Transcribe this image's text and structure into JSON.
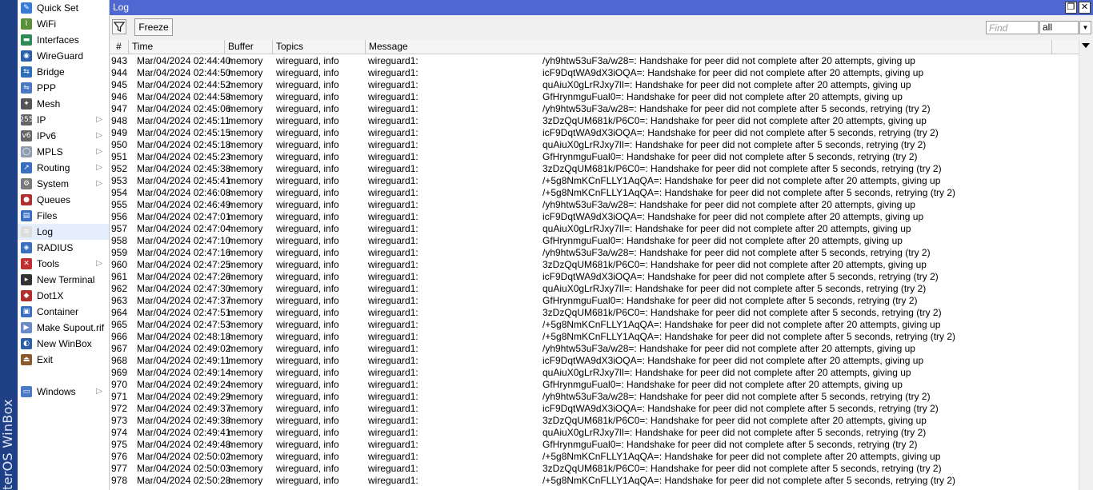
{
  "brand": "terOS WinBox",
  "sidebar": {
    "items": [
      {
        "label": "Quick Set",
        "icon": "quick-set-icon",
        "color": "#3a7bd5",
        "glyph": "✎",
        "submenu": false
      },
      {
        "label": "WiFi",
        "icon": "wifi-icon",
        "color": "#5a8f3c",
        "glyph": "⌇",
        "submenu": false
      },
      {
        "label": "Interfaces",
        "icon": "interfaces-icon",
        "color": "#2e8b57",
        "glyph": "▬",
        "submenu": false
      },
      {
        "label": "WireGuard",
        "icon": "wireguard-icon",
        "color": "#2b5fa8",
        "glyph": "◉",
        "submenu": false
      },
      {
        "label": "Bridge",
        "icon": "bridge-icon",
        "color": "#2f6fb8",
        "glyph": "⇆",
        "submenu": false
      },
      {
        "label": "PPP",
        "icon": "ppp-icon",
        "color": "#4a78c2",
        "glyph": "⇋",
        "submenu": false
      },
      {
        "label": "Mesh",
        "icon": "mesh-icon",
        "color": "#555555",
        "glyph": "✦",
        "submenu": false
      },
      {
        "label": "IP",
        "icon": "ip-icon",
        "color": "#666666",
        "glyph": "255",
        "submenu": true
      },
      {
        "label": "IPv6",
        "icon": "ipv6-icon",
        "color": "#666666",
        "glyph": "v6",
        "submenu": true
      },
      {
        "label": "MPLS",
        "icon": "mpls-icon",
        "color": "#8f9db0",
        "glyph": "◯",
        "submenu": true
      },
      {
        "label": "Routing",
        "icon": "routing-icon",
        "color": "#3a6fc0",
        "glyph": "↗",
        "submenu": true
      },
      {
        "label": "System",
        "icon": "system-icon",
        "color": "#7a7a7a",
        "glyph": "⚙",
        "submenu": true
      },
      {
        "label": "Queues",
        "icon": "queues-icon",
        "color": "#b03030",
        "glyph": "●",
        "submenu": false
      },
      {
        "label": "Files",
        "icon": "files-icon",
        "color": "#3a6fc0",
        "glyph": "▤",
        "submenu": false
      },
      {
        "label": "Log",
        "icon": "log-icon",
        "color": "#dcdcdc",
        "glyph": "≡",
        "submenu": false
      },
      {
        "label": "RADIUS",
        "icon": "radius-icon",
        "color": "#3a6fc0",
        "glyph": "◈",
        "submenu": false
      },
      {
        "label": "Tools",
        "icon": "tools-icon",
        "color": "#c03030",
        "glyph": "✕",
        "submenu": true
      },
      {
        "label": "New Terminal",
        "icon": "terminal-icon",
        "color": "#333333",
        "glyph": "▸",
        "submenu": false
      },
      {
        "label": "Dot1X",
        "icon": "dot1x-icon",
        "color": "#b03030",
        "glyph": "◆",
        "submenu": false
      },
      {
        "label": "Container",
        "icon": "container-icon",
        "color": "#3a6fc0",
        "glyph": "▣",
        "submenu": false
      },
      {
        "label": "Make Supout.rif",
        "icon": "supout-icon",
        "color": "#6a8ac8",
        "glyph": "▶",
        "submenu": false
      },
      {
        "label": "New WinBox",
        "icon": "winbox-icon",
        "color": "#2b5fa8",
        "glyph": "◐",
        "submenu": false
      },
      {
        "label": "Exit",
        "icon": "exit-icon",
        "color": "#8a5a2a",
        "glyph": "⏏",
        "submenu": false
      }
    ],
    "windows": {
      "label": "Windows",
      "icon": "windows-icon",
      "color": "#4a7ac8",
      "glyph": "▭",
      "submenu": true
    }
  },
  "window": {
    "title": "Log",
    "restore_glyph": "❐",
    "close_glyph": "✕"
  },
  "toolbar": {
    "freeze_label": "Freeze",
    "find_placeholder": "Find",
    "topic_value": "all",
    "topic_drop_glyph": "▼"
  },
  "table": {
    "columns": [
      "#",
      "Time",
      "Buffer",
      "Topics",
      "Message"
    ],
    "rows": [
      {
        "num": "943",
        "time": "Mar/04/2024 02:44:40",
        "buffer": "memory",
        "topics": "wireguard, info",
        "msg": "wireguard1:",
        "tail": "/yh9htw53uF3a/w28=: Handshake for peer did not complete after 20 attempts, giving up"
      },
      {
        "num": "944",
        "time": "Mar/04/2024 02:44:50",
        "buffer": "memory",
        "topics": "wireguard, info",
        "msg": "wireguard1:",
        "tail": "icF9DqtWA9dX3iOQA=: Handshake for peer did not complete after 20 attempts, giving up"
      },
      {
        "num": "945",
        "time": "Mar/04/2024 02:44:52",
        "buffer": "memory",
        "topics": "wireguard, info",
        "msg": "wireguard1:",
        "tail": "quAiuX0gLrRJxy7lI=: Handshake for peer did not complete after 20 attempts, giving up"
      },
      {
        "num": "946",
        "time": "Mar/04/2024 02:44:58",
        "buffer": "memory",
        "topics": "wireguard, info",
        "msg": "wireguard1:",
        "tail": "GfHrynmguFual0=: Handshake for peer did not complete after 20 attempts, giving up"
      },
      {
        "num": "947",
        "time": "Mar/04/2024 02:45:06",
        "buffer": "memory",
        "topics": "wireguard, info",
        "msg": "wireguard1:",
        "tail": "/yh9htw53uF3a/w28=: Handshake for peer did not complete after 5 seconds, retrying (try 2)"
      },
      {
        "num": "948",
        "time": "Mar/04/2024 02:45:11",
        "buffer": "memory",
        "topics": "wireguard, info",
        "msg": "wireguard1:",
        "tail": "3zDzQqUM681k/P6C0=: Handshake for peer did not complete after 20 attempts, giving up"
      },
      {
        "num": "949",
        "time": "Mar/04/2024 02:45:15",
        "buffer": "memory",
        "topics": "wireguard, info",
        "msg": "wireguard1:",
        "tail": "icF9DqtWA9dX3iOQA=: Handshake for peer did not complete after 5 seconds, retrying (try 2)"
      },
      {
        "num": "950",
        "time": "Mar/04/2024 02:45:18",
        "buffer": "memory",
        "topics": "wireguard, info",
        "msg": "wireguard1:",
        "tail": "quAiuX0gLrRJxy7lI=: Handshake for peer did not complete after 5 seconds, retrying (try 2)"
      },
      {
        "num": "951",
        "time": "Mar/04/2024 02:45:23",
        "buffer": "memory",
        "topics": "wireguard, info",
        "msg": "wireguard1:",
        "tail": "GfHrynmguFual0=: Handshake for peer did not complete after 5 seconds, retrying (try 2)"
      },
      {
        "num": "952",
        "time": "Mar/04/2024 02:45:38",
        "buffer": "memory",
        "topics": "wireguard, info",
        "msg": "wireguard1:",
        "tail": "3zDzQqUM681k/P6C0=: Handshake for peer did not complete after 5 seconds, retrying (try 2)"
      },
      {
        "num": "953",
        "time": "Mar/04/2024 02:45:41",
        "buffer": "memory",
        "topics": "wireguard, info",
        "msg": "wireguard1:",
        "tail": "/+5g8NmKCnFLLY1AqQA=: Handshake for peer did not complete after 20 attempts, giving up"
      },
      {
        "num": "954",
        "time": "Mar/04/2024 02:46:08",
        "buffer": "memory",
        "topics": "wireguard, info",
        "msg": "wireguard1:",
        "tail": "/+5g8NmKCnFLLY1AqQA=: Handshake for peer did not complete after 5 seconds, retrying (try 2)"
      },
      {
        "num": "955",
        "time": "Mar/04/2024 02:46:49",
        "buffer": "memory",
        "topics": "wireguard, info",
        "msg": "wireguard1:",
        "tail": "/yh9htw53uF3a/w28=: Handshake for peer did not complete after 20 attempts, giving up"
      },
      {
        "num": "956",
        "time": "Mar/04/2024 02:47:01",
        "buffer": "memory",
        "topics": "wireguard, info",
        "msg": "wireguard1:",
        "tail": "icF9DqtWA9dX3iOQA=: Handshake for peer did not complete after 20 attempts, giving up"
      },
      {
        "num": "957",
        "time": "Mar/04/2024 02:47:04",
        "buffer": "memory",
        "topics": "wireguard, info",
        "msg": "wireguard1:",
        "tail": "quAiuX0gLrRJxy7lI=: Handshake for peer did not complete after 20 attempts, giving up"
      },
      {
        "num": "958",
        "time": "Mar/04/2024 02:47:10",
        "buffer": "memory",
        "topics": "wireguard, info",
        "msg": "wireguard1:",
        "tail": "GfHrynmguFual0=: Handshake for peer did not complete after 20 attempts, giving up"
      },
      {
        "num": "959",
        "time": "Mar/04/2024 02:47:16",
        "buffer": "memory",
        "topics": "wireguard, info",
        "msg": "wireguard1:",
        "tail": "/yh9htw53uF3a/w28=: Handshake for peer did not complete after 5 seconds, retrying (try 2)"
      },
      {
        "num": "960",
        "time": "Mar/04/2024 02:47:25",
        "buffer": "memory",
        "topics": "wireguard, info",
        "msg": "wireguard1:",
        "tail": "3zDzQqUM681k/P6C0=: Handshake for peer did not complete after 20 attempts, giving up"
      },
      {
        "num": "961",
        "time": "Mar/04/2024 02:47:26",
        "buffer": "memory",
        "topics": "wireguard, info",
        "msg": "wireguard1:",
        "tail": "icF9DqtWA9dX3iOQA=: Handshake for peer did not complete after 5 seconds, retrying (try 2)"
      },
      {
        "num": "962",
        "time": "Mar/04/2024 02:47:30",
        "buffer": "memory",
        "topics": "wireguard, info",
        "msg": "wireguard1:",
        "tail": "quAiuX0gLrRJxy7lI=: Handshake for peer did not complete after 5 seconds, retrying (try 2)"
      },
      {
        "num": "963",
        "time": "Mar/04/2024 02:47:37",
        "buffer": "memory",
        "topics": "wireguard, info",
        "msg": "wireguard1:",
        "tail": "GfHrynmguFual0=: Handshake for peer did not complete after 5 seconds, retrying (try 2)"
      },
      {
        "num": "964",
        "time": "Mar/04/2024 02:47:51",
        "buffer": "memory",
        "topics": "wireguard, info",
        "msg": "wireguard1:",
        "tail": "3zDzQqUM681k/P6C0=: Handshake for peer did not complete after 5 seconds, retrying (try 2)"
      },
      {
        "num": "965",
        "time": "Mar/04/2024 02:47:53",
        "buffer": "memory",
        "topics": "wireguard, info",
        "msg": "wireguard1:",
        "tail": "/+5g8NmKCnFLLY1AqQA=: Handshake for peer did not complete after 20 attempts, giving up"
      },
      {
        "num": "966",
        "time": "Mar/04/2024 02:48:18",
        "buffer": "memory",
        "topics": "wireguard, info",
        "msg": "wireguard1:",
        "tail": "/+5g8NmKCnFLLY1AqQA=: Handshake for peer did not complete after 5 seconds, retrying (try 2)"
      },
      {
        "num": "967",
        "time": "Mar/04/2024 02:49:02",
        "buffer": "memory",
        "topics": "wireguard, info",
        "msg": "wireguard1:",
        "tail": "/yh9htw53uF3a/w28=: Handshake for peer did not complete after 20 attempts, giving up"
      },
      {
        "num": "968",
        "time": "Mar/04/2024 02:49:11",
        "buffer": "memory",
        "topics": "wireguard, info",
        "msg": "wireguard1:",
        "tail": "icF9DqtWA9dX3iOQA=: Handshake for peer did not complete after 20 attempts, giving up"
      },
      {
        "num": "969",
        "time": "Mar/04/2024 02:49:14",
        "buffer": "memory",
        "topics": "wireguard, info",
        "msg": "wireguard1:",
        "tail": "quAiuX0gLrRJxy7lI=: Handshake for peer did not complete after 20 attempts, giving up"
      },
      {
        "num": "970",
        "time": "Mar/04/2024 02:49:24",
        "buffer": "memory",
        "topics": "wireguard, info",
        "msg": "wireguard1:",
        "tail": "GfHrynmguFual0=: Handshake for peer did not complete after 20 attempts, giving up"
      },
      {
        "num": "971",
        "time": "Mar/04/2024 02:49:29",
        "buffer": "memory",
        "topics": "wireguard, info",
        "msg": "wireguard1:",
        "tail": "/yh9htw53uF3a/w28=: Handshake for peer did not complete after 5 seconds, retrying (try 2)"
      },
      {
        "num": "972",
        "time": "Mar/04/2024 02:49:37",
        "buffer": "memory",
        "topics": "wireguard, info",
        "msg": "wireguard1:",
        "tail": "icF9DqtWA9dX3iOQA=: Handshake for peer did not complete after 5 seconds, retrying (try 2)"
      },
      {
        "num": "973",
        "time": "Mar/04/2024 02:49:38",
        "buffer": "memory",
        "topics": "wireguard, info",
        "msg": "wireguard1:",
        "tail": "3zDzQqUM681k/P6C0=: Handshake for peer did not complete after 20 attempts, giving up"
      },
      {
        "num": "974",
        "time": "Mar/04/2024 02:49:41",
        "buffer": "memory",
        "topics": "wireguard, info",
        "msg": "wireguard1:",
        "tail": "quAiuX0gLrRJxy7lI=: Handshake for peer did not complete after 5 seconds, retrying (try 2)"
      },
      {
        "num": "975",
        "time": "Mar/04/2024 02:49:48",
        "buffer": "memory",
        "topics": "wireguard, info",
        "msg": "wireguard1:",
        "tail": "GfHrynmguFual0=: Handshake for peer did not complete after 5 seconds, retrying (try 2)"
      },
      {
        "num": "976",
        "time": "Mar/04/2024 02:50:02",
        "buffer": "memory",
        "topics": "wireguard, info",
        "msg": "wireguard1:",
        "tail": "/+5g8NmKCnFLLY1AqQA=: Handshake for peer did not complete after 20 attempts, giving up"
      },
      {
        "num": "977",
        "time": "Mar/04/2024 02:50:03",
        "buffer": "memory",
        "topics": "wireguard, info",
        "msg": "wireguard1:",
        "tail": "3zDzQqUM681k/P6C0=: Handshake for peer did not complete after 5 seconds, retrying (try 2)"
      },
      {
        "num": "978",
        "time": "Mar/04/2024 02:50:28",
        "buffer": "memory",
        "topics": "wireguard, info",
        "msg": "wireguard1:",
        "tail": "/+5g8NmKCnFLLY1AqQA=: Handshake for peer did not complete after 5 seconds, retrying (try 2)"
      }
    ]
  },
  "colors": {
    "titlebar": "#4f67d1",
    "brand_strip": "#1f3f86",
    "active_menu": "#e5eefc"
  }
}
